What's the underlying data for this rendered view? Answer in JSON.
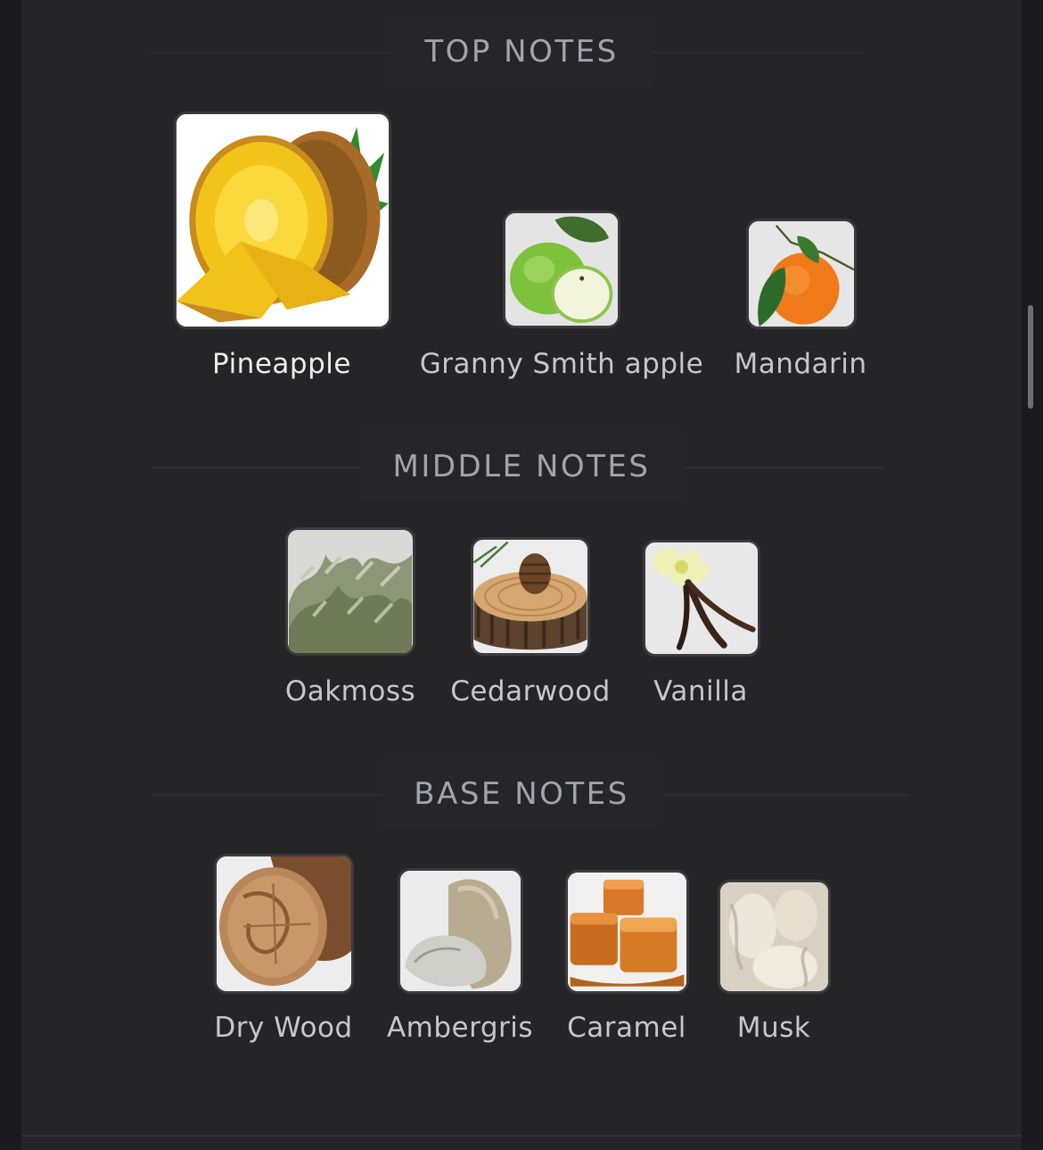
{
  "sections": [
    {
      "title": "TOP NOTES",
      "notes": [
        {
          "name": "Pineapple",
          "icon": "pineapple-icon",
          "emphasis": true
        },
        {
          "name": "Granny Smith apple",
          "icon": "green-apple-icon"
        },
        {
          "name": "Mandarin",
          "icon": "mandarin-icon"
        }
      ]
    },
    {
      "title": "MIDDLE NOTES",
      "notes": [
        {
          "name": "Oakmoss",
          "icon": "oakmoss-icon"
        },
        {
          "name": "Cedarwood",
          "icon": "cedarwood-icon"
        },
        {
          "name": "Vanilla",
          "icon": "vanilla-icon"
        }
      ]
    },
    {
      "title": "BASE NOTES",
      "notes": [
        {
          "name": "Dry Wood",
          "icon": "dry-wood-icon"
        },
        {
          "name": "Ambergris",
          "icon": "ambergris-icon"
        },
        {
          "name": "Caramel",
          "icon": "caramel-icon"
        },
        {
          "name": "Musk",
          "icon": "musk-icon"
        }
      ]
    }
  ]
}
